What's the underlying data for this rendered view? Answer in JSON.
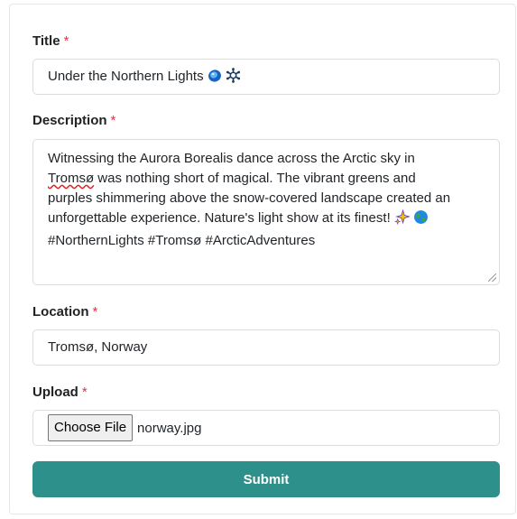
{
  "form": {
    "title": {
      "label": "Title",
      "required_mark": "*",
      "value": "Under the Northern Lights"
    },
    "description": {
      "label": "Description",
      "required_mark": "*",
      "line1": "Witnessing the Aurora Borealis dance across the Arctic sky in",
      "misspelled_word": "Tromsø",
      "line2_rest": " was nothing short of magical. The vibrant greens and",
      "line3": "purples shimmering above the snow-covered landscape created an",
      "line4": "unforgettable experience. Nature's light show at its finest!",
      "line5": "#NorthernLights #Tromsø #ArcticAdventures"
    },
    "location": {
      "label": "Location",
      "required_mark": "*",
      "value": "Tromsø, Norway"
    },
    "upload": {
      "label": "Upload",
      "required_mark": "*",
      "button_label": "Choose File",
      "file_name": "norway.jpg"
    },
    "submit_label": "Submit"
  },
  "icons": {
    "title_emojis": [
      "blue-gem-icon",
      "snowflake-icon"
    ],
    "description_emojis": [
      "sparkles-icon",
      "globe-icon"
    ]
  },
  "colors": {
    "accent": "#2e908a",
    "required": "#dc3545"
  }
}
